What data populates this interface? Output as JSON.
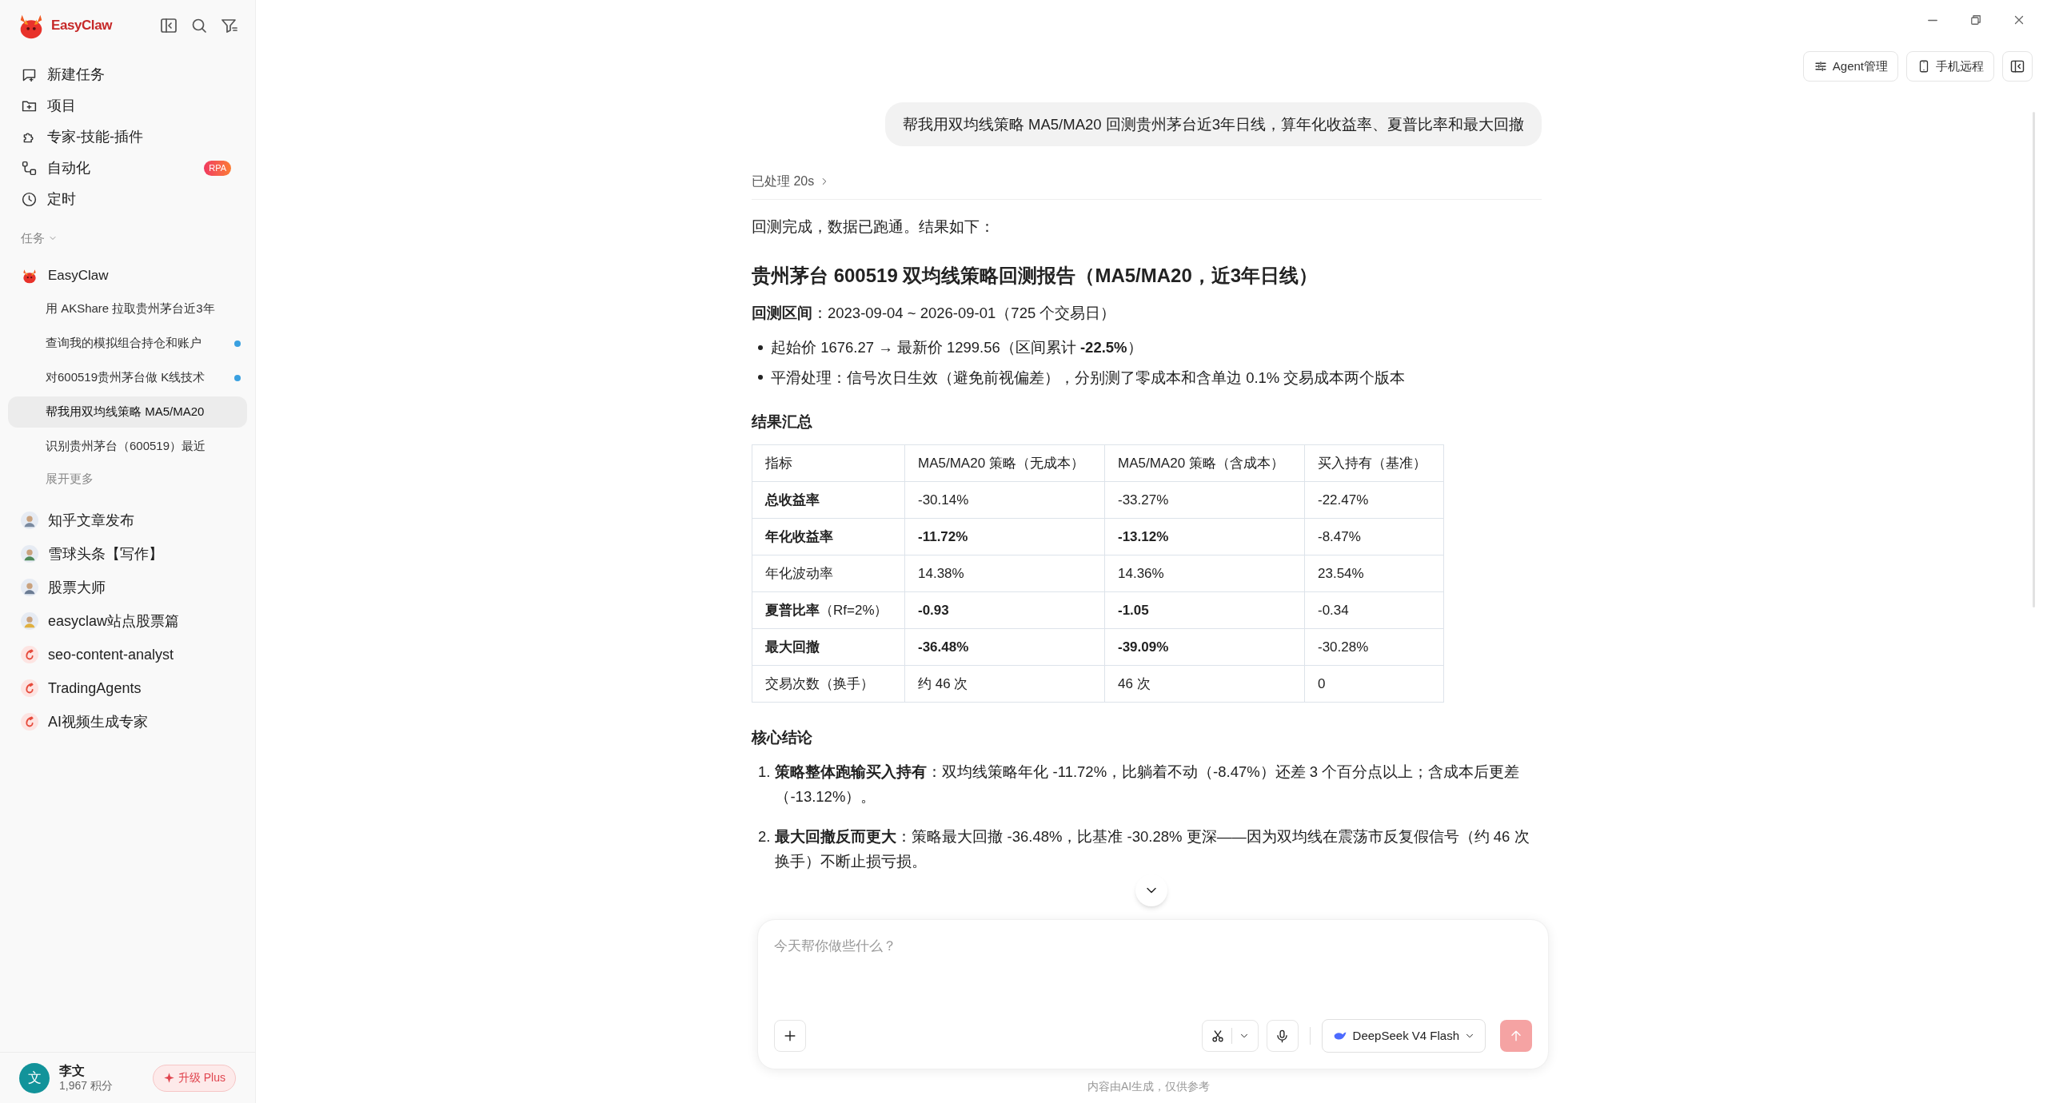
{
  "sidebar": {
    "brand": "EasyClaw",
    "nav": [
      {
        "label": "新建任务"
      },
      {
        "label": "项目"
      },
      {
        "label": "专家-技能-插件"
      },
      {
        "label": "自动化",
        "badge": "RPA"
      },
      {
        "label": "定时"
      }
    ],
    "section": "任务",
    "group": {
      "title": "EasyClaw",
      "tasks": [
        {
          "label": "用 AKShare 拉取贵州茅台近3年",
          "selected": false,
          "unread": false
        },
        {
          "label": "查询我的模拟组合持仓和账户",
          "selected": false,
          "unread": true
        },
        {
          "label": "对600519贵州茅台做 K线技术",
          "selected": false,
          "unread": true
        },
        {
          "label": "帮我用双均线策略 MA5/MA20",
          "selected": true,
          "unread": false
        },
        {
          "label": "识别贵州茅台（600519）最近",
          "selected": false,
          "unread": false
        }
      ],
      "more": "展开更多"
    },
    "agents": [
      {
        "name": "知乎文章发布",
        "kind": "person"
      },
      {
        "name": "雪球头条【写作】",
        "kind": "person"
      },
      {
        "name": "股票大师",
        "kind": "person"
      },
      {
        "name": "easyclaw站点股票篇",
        "kind": "person"
      },
      {
        "name": "seo-content-analyst",
        "kind": "brand"
      },
      {
        "name": "TradingAgents",
        "kind": "brand"
      },
      {
        "name": "AI视频生成专家",
        "kind": "brand"
      }
    ],
    "user": {
      "avatar": "文",
      "name": "李文",
      "points": "1,967 积分"
    },
    "upgrade": "升级 Plus"
  },
  "toolbar": {
    "buttons": [
      {
        "label": "Agent管理"
      },
      {
        "label": "手机远程"
      }
    ]
  },
  "chat": {
    "user_message": "帮我用双均线策略 MA5/MA20 回测贵州茅台近3年日线，算年化收益率、夏普比率和最大回撤",
    "processed": "已处理 20s",
    "intro": "回测完成，数据已跑通。结果如下：",
    "heading": "贵州茅台 600519 双均线策略回测报告（MA5/MA20，近3年日线）",
    "range": "**回测区间**：2023-09-04 ~ 2026-09-01（725 个交易日）",
    "bullets": [
      "起始价 1676.27 → 最新价 1299.56（区间累计 **-22.5%**）",
      "平滑处理：信号次日生效（避免前视偏差），分别测了零成本和含单边 0.1% 交易成本两个版本"
    ],
    "summary_title": "结果汇总",
    "table": {
      "columns": [
        "指标",
        "MA5/MA20 策略（无成本）",
        "MA5/MA20 策略（含成本）",
        "买入持有（基准）"
      ],
      "rows": [
        [
          {
            "text": "总收益率",
            "bold": true
          },
          {
            "text": "-30.14%",
            "bold": false
          },
          {
            "text": "-33.27%",
            "bold": false
          },
          {
            "text": "-22.47%",
            "bold": false
          }
        ],
        [
          {
            "text": "年化收益率",
            "bold": true
          },
          {
            "text": "-11.72%",
            "bold": true
          },
          {
            "text": "-13.12%",
            "bold": true
          },
          {
            "text": "-8.47%",
            "bold": false
          }
        ],
        [
          {
            "text": "年化波动率",
            "bold": false
          },
          {
            "text": "14.38%",
            "bold": false
          },
          {
            "text": "14.36%",
            "bold": false
          },
          {
            "text": "23.54%",
            "bold": false
          }
        ],
        [
          {
            "text": "**夏普比率**（Rf=2%）",
            "bold": false
          },
          {
            "text": "-0.93",
            "bold": true
          },
          {
            "text": "-1.05",
            "bold": true
          },
          {
            "text": "-0.34",
            "bold": false
          }
        ],
        [
          {
            "text": "最大回撤",
            "bold": true
          },
          {
            "text": "-36.48%",
            "bold": true
          },
          {
            "text": "-39.09%",
            "bold": true
          },
          {
            "text": "-30.28%",
            "bold": false
          }
        ],
        [
          {
            "text": "交易次数（换手）",
            "bold": false
          },
          {
            "text": "约 46 次",
            "bold": false
          },
          {
            "text": "46 次",
            "bold": false
          },
          {
            "text": "0",
            "bold": false
          }
        ]
      ]
    },
    "conclusion_title": "核心结论",
    "conclusions": [
      {
        "number": "1.",
        "text": "**策略整体跑输买入持有**：双均线策略年化 -11.72%，比躺着不动（-8.47%）还差 3 个百分点以上；含成本后更差（-13.12%）。"
      },
      {
        "number": "2.",
        "text": "**最大回撤反而更大**：策略最大回撤 -36.48%，比基准 -30.28% 更深——因为双均线在震荡市反复假信号（约 46 次换手）不断止损亏损。"
      }
    ]
  },
  "composer": {
    "placeholder": "今天帮你做些什么？",
    "model": "DeepSeek V4 Flash"
  },
  "footer": "内容由AI生成，仅供参考"
}
